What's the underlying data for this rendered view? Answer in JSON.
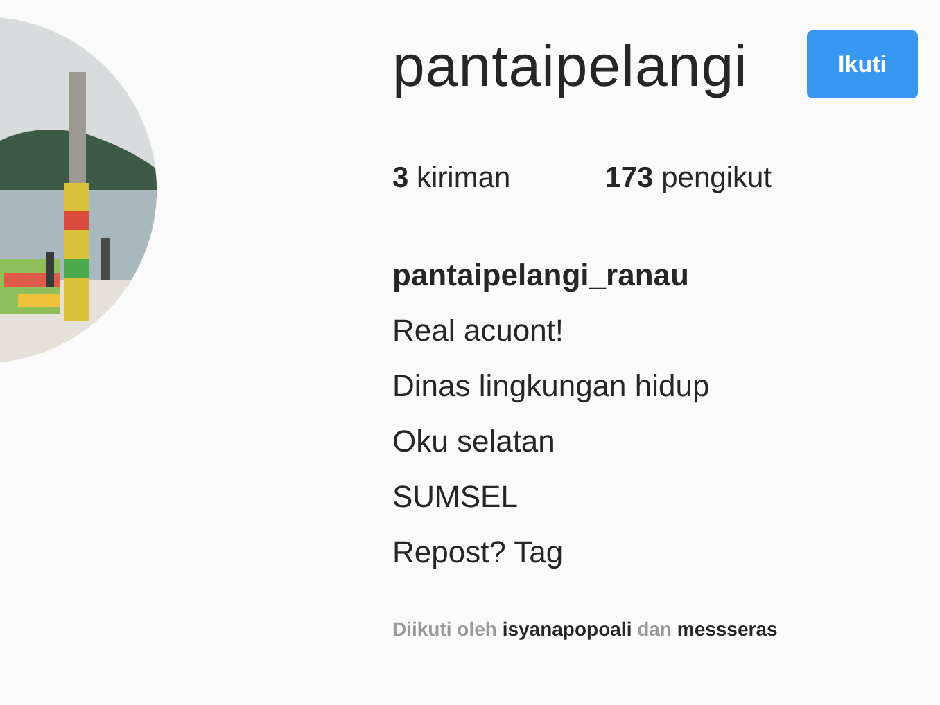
{
  "profile": {
    "username": "pantaipelangi",
    "follow_button": "Ikuti",
    "stats": [
      "**3** kiriman",
      "**173** pengikut"
    ],
    "full_name": "pantaipelangi_ranau",
    "bio_lines": [
      "Real acuont!",
      "Dinas lingkungan hidup",
      "Oku selatan",
      "SUMSEL",
      "Repost? Tag"
    ],
    "followed_by": {
      "prefix": "Diikuti oleh",
      "users": [
        "isyanapopoali",
        "messseras"
      ],
      "joiner": "dan"
    }
  }
}
